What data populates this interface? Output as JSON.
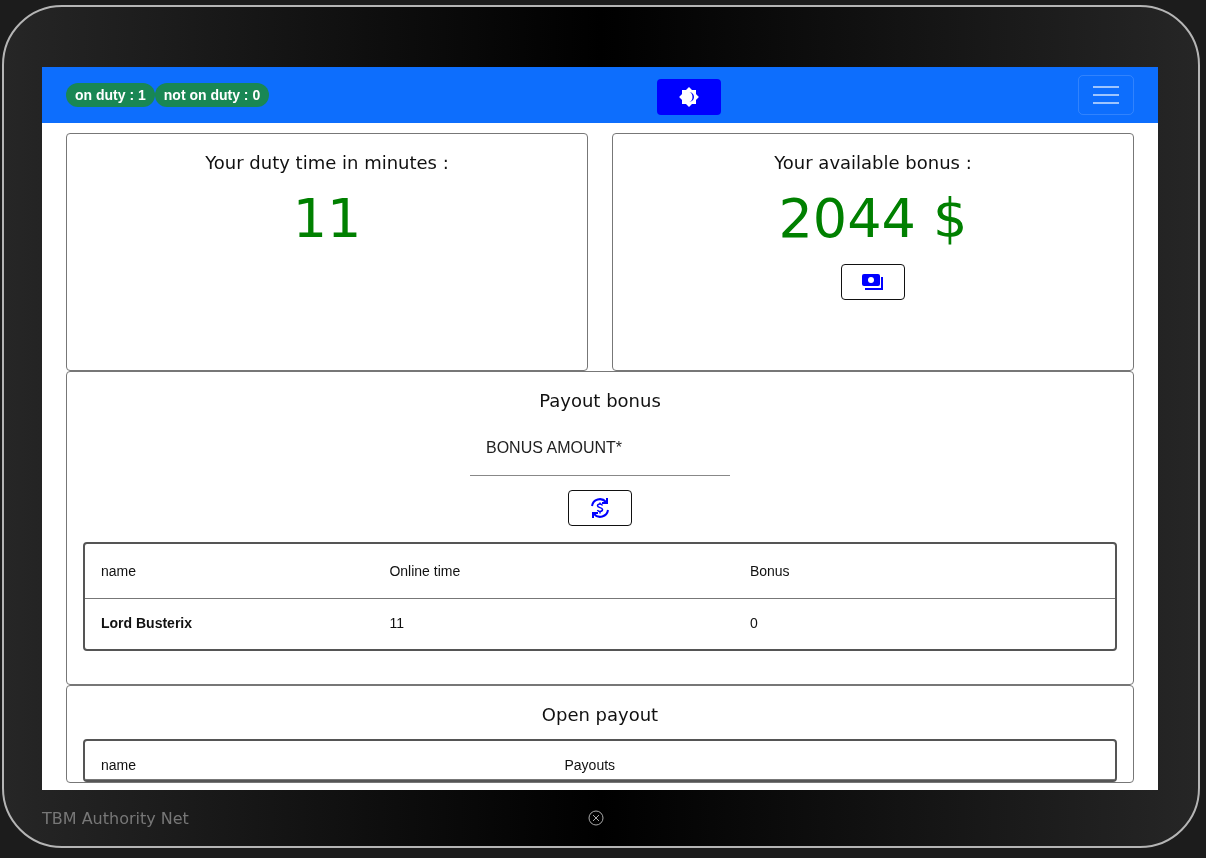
{
  "navbar": {
    "badges": [
      {
        "label": "on duty : 1"
      },
      {
        "label": "not on duty : 0"
      }
    ]
  },
  "duty_card": {
    "title": "Your duty time in minutes :",
    "value": "11"
  },
  "bonus_card": {
    "title": "Your available bonus :",
    "value": "2044 $"
  },
  "payout_bonus": {
    "title": "Payout bonus",
    "field": {
      "placeholder": "BONUS AMOUNT*"
    },
    "table": {
      "columns": [
        "name",
        "Online time",
        "Bonus"
      ],
      "rows": [
        [
          "Lord Busterix",
          "11",
          "0"
        ]
      ]
    }
  },
  "open_payout": {
    "title": "Open payout",
    "table": {
      "columns": [
        "name",
        "Payouts"
      ]
    }
  },
  "footer": {
    "title": "TBM Authority Net"
  }
}
